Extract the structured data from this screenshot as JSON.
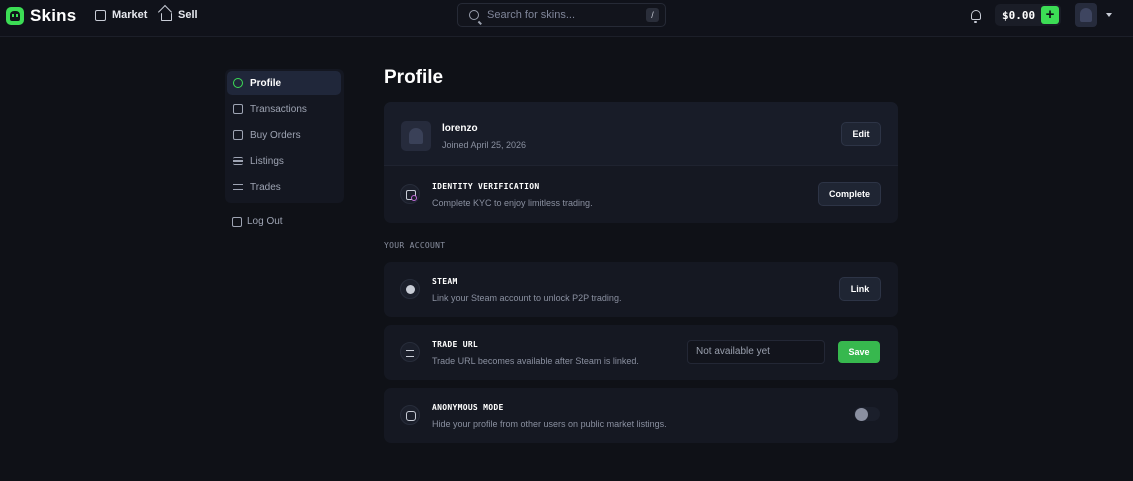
{
  "header": {
    "brand": "Skins",
    "nav": [
      {
        "label": "Market",
        "icon": "store-icon"
      },
      {
        "label": "Sell",
        "icon": "home-icon"
      }
    ],
    "search_placeholder": "Search for skins...",
    "search_shortcut": "/",
    "balance": "$0.00",
    "add_funds": "+"
  },
  "sidebar": {
    "items": [
      {
        "label": "Profile",
        "icon": "user-circle-icon",
        "active": true
      },
      {
        "label": "Transactions",
        "icon": "receipt-icon"
      },
      {
        "label": "Buy Orders",
        "icon": "cart-icon"
      },
      {
        "label": "Listings",
        "icon": "list-icon"
      },
      {
        "label": "Trades",
        "icon": "arrows-swap-icon"
      }
    ],
    "logout": "Log Out"
  },
  "main": {
    "title": "Profile",
    "profile": {
      "username": "lorenzo",
      "joined": "Joined April 25, 2026",
      "edit_label": "Edit"
    },
    "identity": {
      "title": "IDENTITY VERIFICATION",
      "subtitle": "Complete KYC to enjoy limitless trading.",
      "button": "Complete"
    },
    "section_label": "YOUR ACCOUNT",
    "steam": {
      "title": "STEAM",
      "subtitle": "Link your Steam account to unlock P2P trading.",
      "button": "Link"
    },
    "trade_url": {
      "title": "TRADE URL",
      "subtitle": "Trade URL becomes available after Steam is linked.",
      "placeholder": "Not available yet",
      "button": "Save"
    },
    "anonymous": {
      "title": "ANONYMOUS MODE",
      "subtitle": "Hide your profile from other users on public market listings.",
      "enabled": false
    }
  },
  "colors": {
    "accent": "#3cdd55",
    "background": "#0f1117",
    "card": "#151822"
  }
}
